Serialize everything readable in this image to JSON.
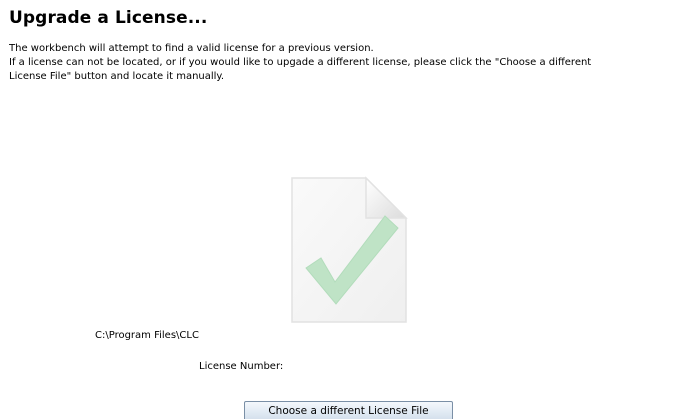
{
  "page": {
    "title": "Upgrade a License...",
    "description_lines": [
      "The workbench will attempt to find a valid license for a previous version.",
      "If a license can not be located, or if you would like to upgade a different license, please click the \"Choose a different",
      "License File\" button and locate it manually."
    ]
  },
  "license": {
    "file_path": "C:\\Program Files\\CLC",
    "number_label": "License Number:",
    "number_value": ""
  },
  "actions": {
    "choose_file_label": "Choose a different License File"
  },
  "icons": {
    "license_file": "document-checkmark-icon"
  },
  "colors": {
    "checkmark": "#bfe3c6",
    "document_fill": "#f7f7f7",
    "document_edge": "#dedede",
    "button_border": "#7a8fa6"
  }
}
